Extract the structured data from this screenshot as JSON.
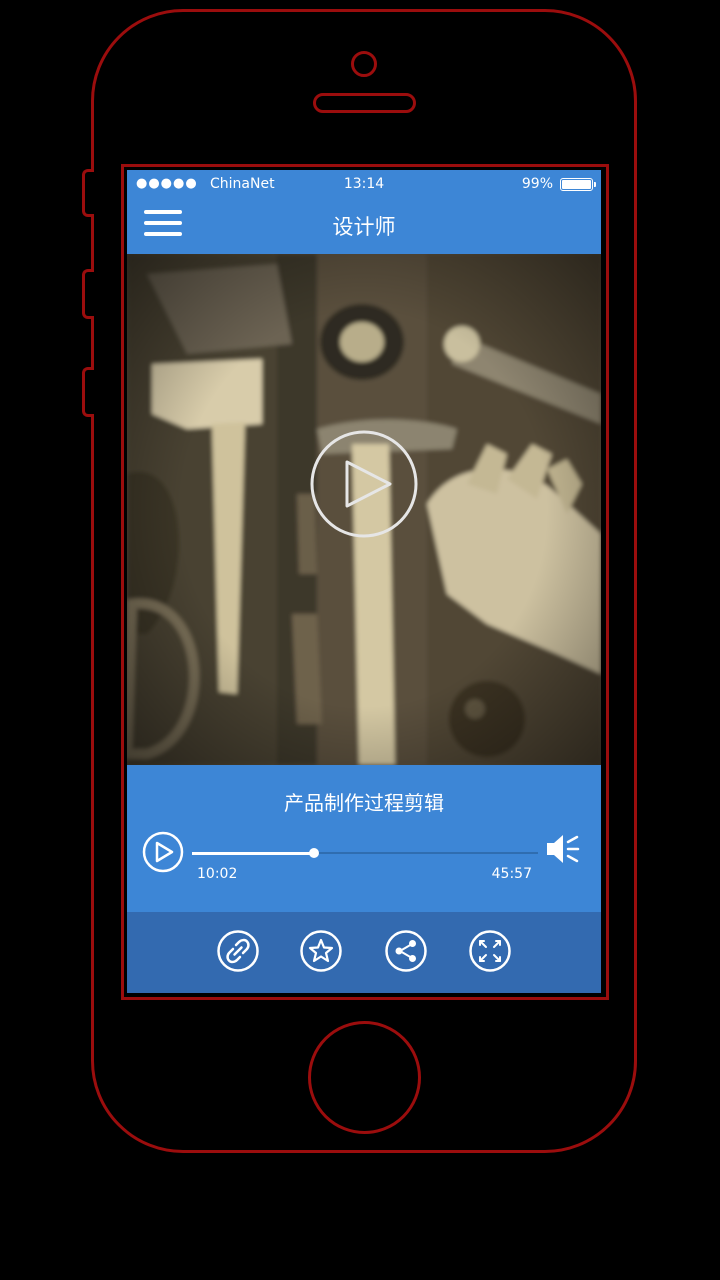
{
  "status_bar": {
    "signal": "●●●●●",
    "carrier": "ChinaNet",
    "time": "13:14",
    "battery": "99%"
  },
  "nav": {
    "title": "设计师",
    "menu_icon": "hamburger-menu-icon"
  },
  "video": {
    "play_icon": "play-circle-icon"
  },
  "player": {
    "title": "产品制作过程剪辑",
    "current_time": "10:02",
    "duration": "45:57",
    "progress_fraction": 0.353,
    "play_icon": "play-circle-icon",
    "volume_icon": "volume-icon"
  },
  "toolbar": {
    "items": [
      {
        "icon": "link-icon"
      },
      {
        "icon": "star-icon"
      },
      {
        "icon": "share-icon"
      },
      {
        "icon": "fullscreen-icon"
      }
    ]
  },
  "colors": {
    "accent": "#3d86d6",
    "toolbar": "#336ab0",
    "frame": "#9b0d0d"
  }
}
